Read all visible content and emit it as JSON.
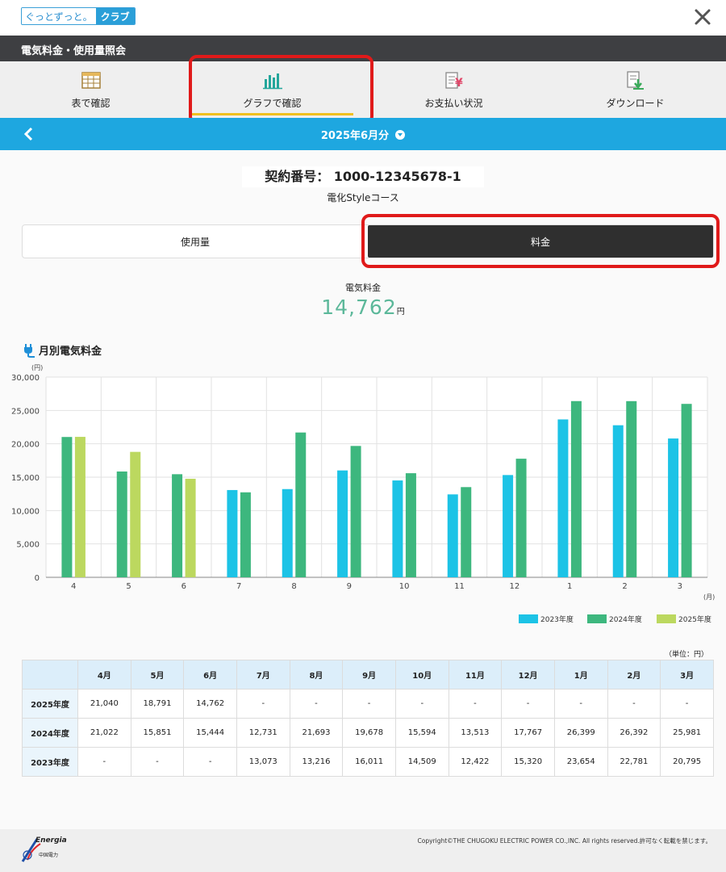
{
  "header": {
    "logo_left": "ぐっとずっと。",
    "logo_right": "クラブ"
  },
  "title": "電気料金・使用量照会",
  "nav": [
    {
      "label": "表で確認",
      "icon": "table-icon"
    },
    {
      "label": "グラフで確認",
      "icon": "bar-chart-icon",
      "active": true
    },
    {
      "label": "お支払い状況",
      "icon": "yen-document-icon"
    },
    {
      "label": "ダウンロード",
      "icon": "download-icon"
    }
  ],
  "month": {
    "label": "2025年6月分"
  },
  "contract": {
    "label": "契約番号：  1000-12345678-1",
    "course": "電化Styleコース"
  },
  "toggle": {
    "usage": "使用量",
    "fee": "料金",
    "selected": "fee"
  },
  "fee": {
    "label": "電気料金",
    "value": "14,762",
    "unit": "円"
  },
  "chart_title": "月別電気料金",
  "chart_data": {
    "type": "bar",
    "title": "月別電気料金",
    "ylabel": "(円)",
    "xlabel": "(月)",
    "categories": [
      "4",
      "5",
      "6",
      "7",
      "8",
      "9",
      "10",
      "11",
      "12",
      "1",
      "2",
      "3"
    ],
    "ylim": [
      0,
      30000
    ],
    "yticks": [
      "0",
      "5,000",
      "10,000",
      "15,000",
      "20,000",
      "25,000",
      "30,000"
    ],
    "grid": true,
    "legend_position": "bottom-right",
    "series": [
      {
        "name": "2023年度",
        "color": "#1cc3e6",
        "values": [
          null,
          null,
          null,
          13073,
          13216,
          16011,
          14509,
          12422,
          15320,
          23654,
          22781,
          20795
        ]
      },
      {
        "name": "2024年度",
        "color": "#3db77e",
        "values": [
          21022,
          15851,
          15444,
          12731,
          21693,
          19678,
          15594,
          13513,
          17767,
          26399,
          26392,
          25981
        ]
      },
      {
        "name": "2025年度",
        "color": "#bcd85f",
        "values": [
          21040,
          18791,
          14762,
          null,
          null,
          null,
          null,
          null,
          null,
          null,
          null,
          null
        ]
      }
    ]
  },
  "table": {
    "unit": "（単位：円）",
    "months": [
      "4月",
      "5月",
      "6月",
      "7月",
      "8月",
      "9月",
      "10月",
      "11月",
      "12月",
      "1月",
      "2月",
      "3月"
    ],
    "rows": [
      {
        "year": "2025年度",
        "values": [
          "21,040",
          "18,791",
          "14,762",
          "-",
          "-",
          "-",
          "-",
          "-",
          "-",
          "-",
          "-",
          "-"
        ]
      },
      {
        "year": "2024年度",
        "values": [
          "21,022",
          "15,851",
          "15,444",
          "12,731",
          "21,693",
          "19,678",
          "15,594",
          "13,513",
          "17,767",
          "26,399",
          "26,392",
          "25,981"
        ]
      },
      {
        "year": "2023年度",
        "values": [
          "-",
          "-",
          "-",
          "13,073",
          "13,216",
          "16,011",
          "14,509",
          "12,422",
          "15,320",
          "23,654",
          "22,781",
          "20,795"
        ]
      }
    ]
  },
  "footer": {
    "brand": "Energia",
    "brand_sub": "中国電力",
    "copyright": "Copyright©THE CHUGOKU ELECTRIC POWER CO.,INC. All rights reserved.許可なく転載を禁じます。"
  }
}
